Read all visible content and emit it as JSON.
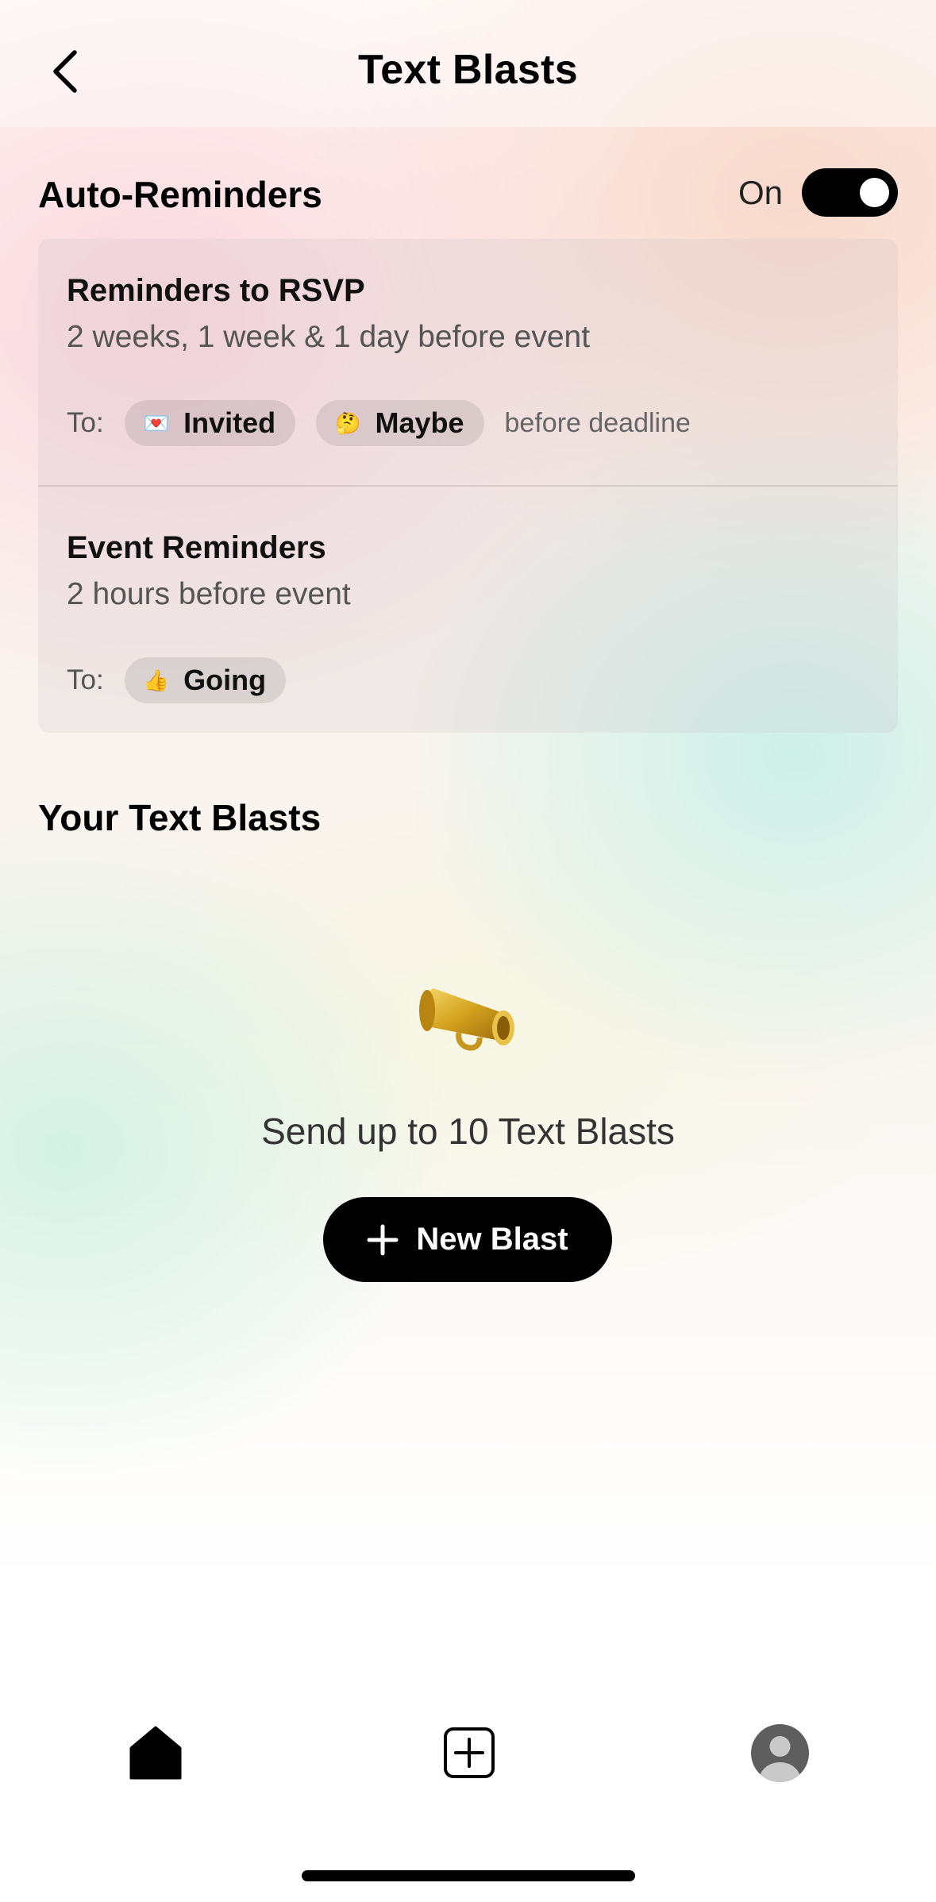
{
  "header": {
    "title": "Text Blasts"
  },
  "auto_reminders": {
    "heading": "Auto-Reminders",
    "toggle_label": "On",
    "toggle_on": true,
    "rsvp": {
      "title": "Reminders to RSVP",
      "schedule": "2 weeks, 1 week & 1 day before event",
      "to_label": "To:",
      "chips": [
        {
          "emoji": "💌",
          "label": "Invited"
        },
        {
          "emoji": "🤔",
          "label": "Maybe"
        }
      ],
      "trailing": "before deadline"
    },
    "event": {
      "title": "Event Reminders",
      "schedule": "2 hours before event",
      "to_label": "To:",
      "chips": [
        {
          "emoji": "👍",
          "label": "Going"
        }
      ]
    }
  },
  "text_blasts": {
    "heading": "Your Text Blasts",
    "icon": "megaphone-icon",
    "empty_text": "Send up to 10 Text Blasts",
    "new_button_label": "New Blast"
  },
  "tab_bar": {
    "items": [
      "home-icon",
      "add-square-icon",
      "profile-avatar-icon"
    ]
  },
  "colors": {
    "button_bg": "#000000",
    "chip_bg": "#e6dcdf"
  }
}
